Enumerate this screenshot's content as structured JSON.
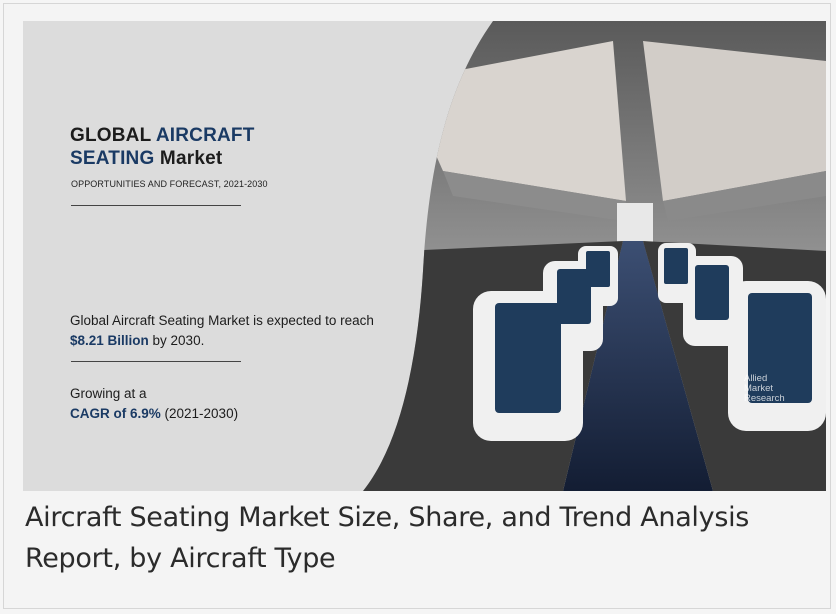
{
  "image": {
    "title_part1": "GLOBAL ",
    "title_part2": "AIRCRAFT",
    "title_part3": "SEATING",
    "title_part4": " Market",
    "subtitle": "OPPORTUNITIES AND FORECAST, 2021-2030",
    "expect_text_before": "Global Aircraft Seating Market is expected to reach ",
    "expect_value": "$8.21 Billion",
    "expect_text_after": " by 2030.",
    "growing_text": "Growing at a",
    "cagr_value": "CAGR of 6.9%",
    "cagr_period": " (2021-2030)",
    "watermark_line1": "Allied",
    "watermark_line2": "Market",
    "watermark_line3": "Research",
    "photo_icon": "airplane-cabin-photo",
    "colors": {
      "accent": "#1a3a64",
      "seat": "#f2f2f2",
      "seat_back": "#1f3c5c",
      "aisle": "#1c2b4a"
    }
  },
  "caption": {
    "text": "Aircraft Seating Market Size, Share,  and Trend Analysis Report, by Aircraft Type"
  }
}
